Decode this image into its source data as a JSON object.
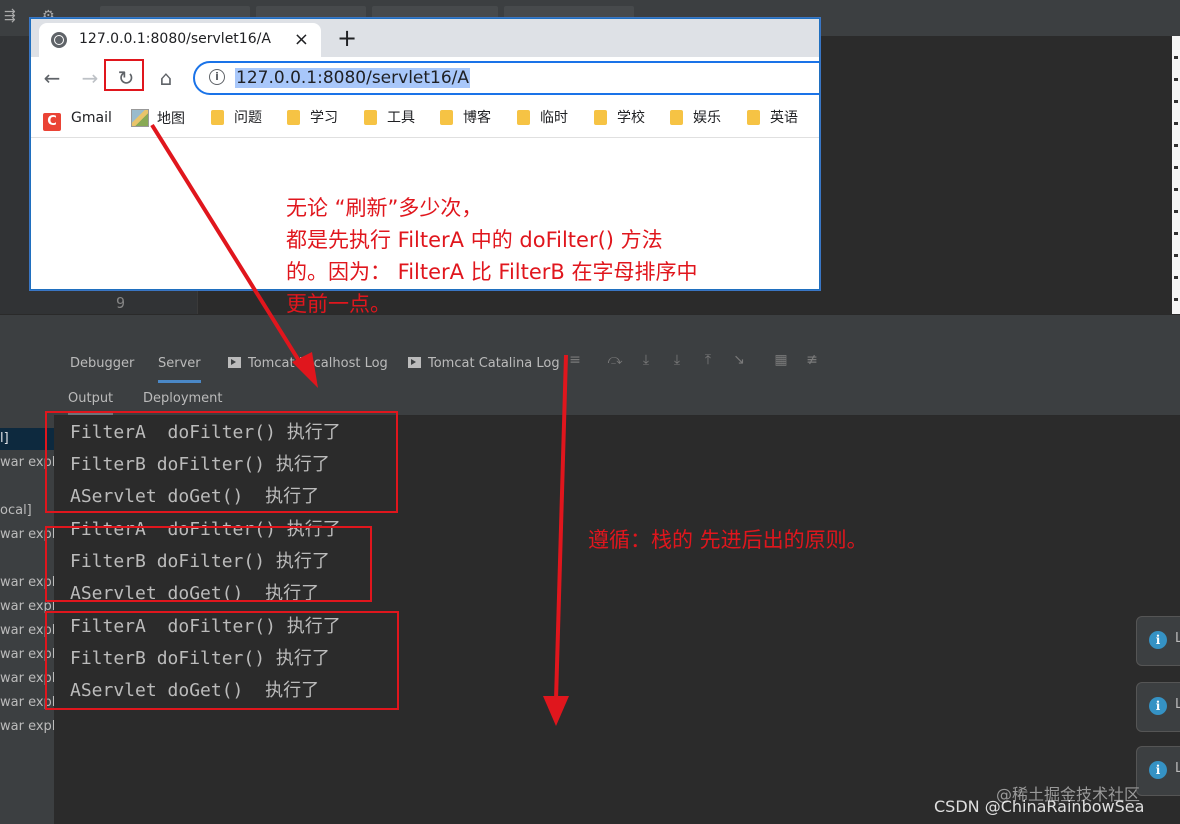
{
  "browser": {
    "tab_title": "127.0.0.1:8080/servlet16/A",
    "tab_close": "×",
    "new_tab": "+",
    "url": "127.0.0.1:8080/servlet16/A",
    "bookmarks": [
      {
        "label": "Gmail",
        "icon": "gmail-icon"
      },
      {
        "label": "地图",
        "icon": "map-icon"
      },
      {
        "label": "问题",
        "icon": "folder-icon"
      },
      {
        "label": "学习",
        "icon": "folder-icon"
      },
      {
        "label": "工具",
        "icon": "folder-icon"
      },
      {
        "label": "博客",
        "icon": "folder-icon"
      },
      {
        "label": "临时",
        "icon": "folder-icon"
      },
      {
        "label": "学校",
        "icon": "folder-icon"
      },
      {
        "label": "娱乐",
        "icon": "folder-icon"
      },
      {
        "label": "英语",
        "icon": "folder-icon"
      }
    ]
  },
  "editor": {
    "line_number": "9"
  },
  "tool_window": {
    "tabs": [
      "Debugger",
      "Server",
      "Tomcat Localhost Log",
      "Tomcat Catalina Log"
    ],
    "active_tab": "Server",
    "sub_tabs": [
      "Output",
      "Deployment"
    ],
    "active_sub_tab": "Output"
  },
  "services_tree": {
    "items": [
      "l]",
      "war expl",
      "ocal]",
      "war expl",
      "war expl",
      "war expl",
      "war expl",
      "war expl",
      "war expl",
      "war expl",
      "war expl"
    ]
  },
  "console": {
    "lines": [
      "FilterA  doFilter() 执行了",
      "FilterB doFilter() 执行了",
      "AServlet doGet()  执行了",
      "FilterA  doFilter() 执行了",
      "FilterB doFilter() 执行了",
      "AServlet doGet()  执行了",
      "FilterA  doFilter() 执行了",
      "FilterB doFilter() 执行了",
      "AServlet doGet()  执行了"
    ]
  },
  "annotations": {
    "note_top": [
      "无论 “刷新”多少次，",
      "都是先执行 FilterA 中的 doFilter() 方法",
      "的。因为： FilterA 比 FilterB 在字母排序中",
      "更前一点。"
    ],
    "note_right": "遵循：栈的 先进后出的原则。",
    "accent_color": "#e0161d"
  },
  "notifications": [
    {
      "icon": "info-icon",
      "letter": "L"
    },
    {
      "icon": "info-icon",
      "letter": "L"
    },
    {
      "icon": "info-icon",
      "letter": "L"
    }
  ],
  "watermarks": {
    "juejin": "@稀土掘金技术社区",
    "csdn": "CSDN @ChinaRainbowSea"
  }
}
